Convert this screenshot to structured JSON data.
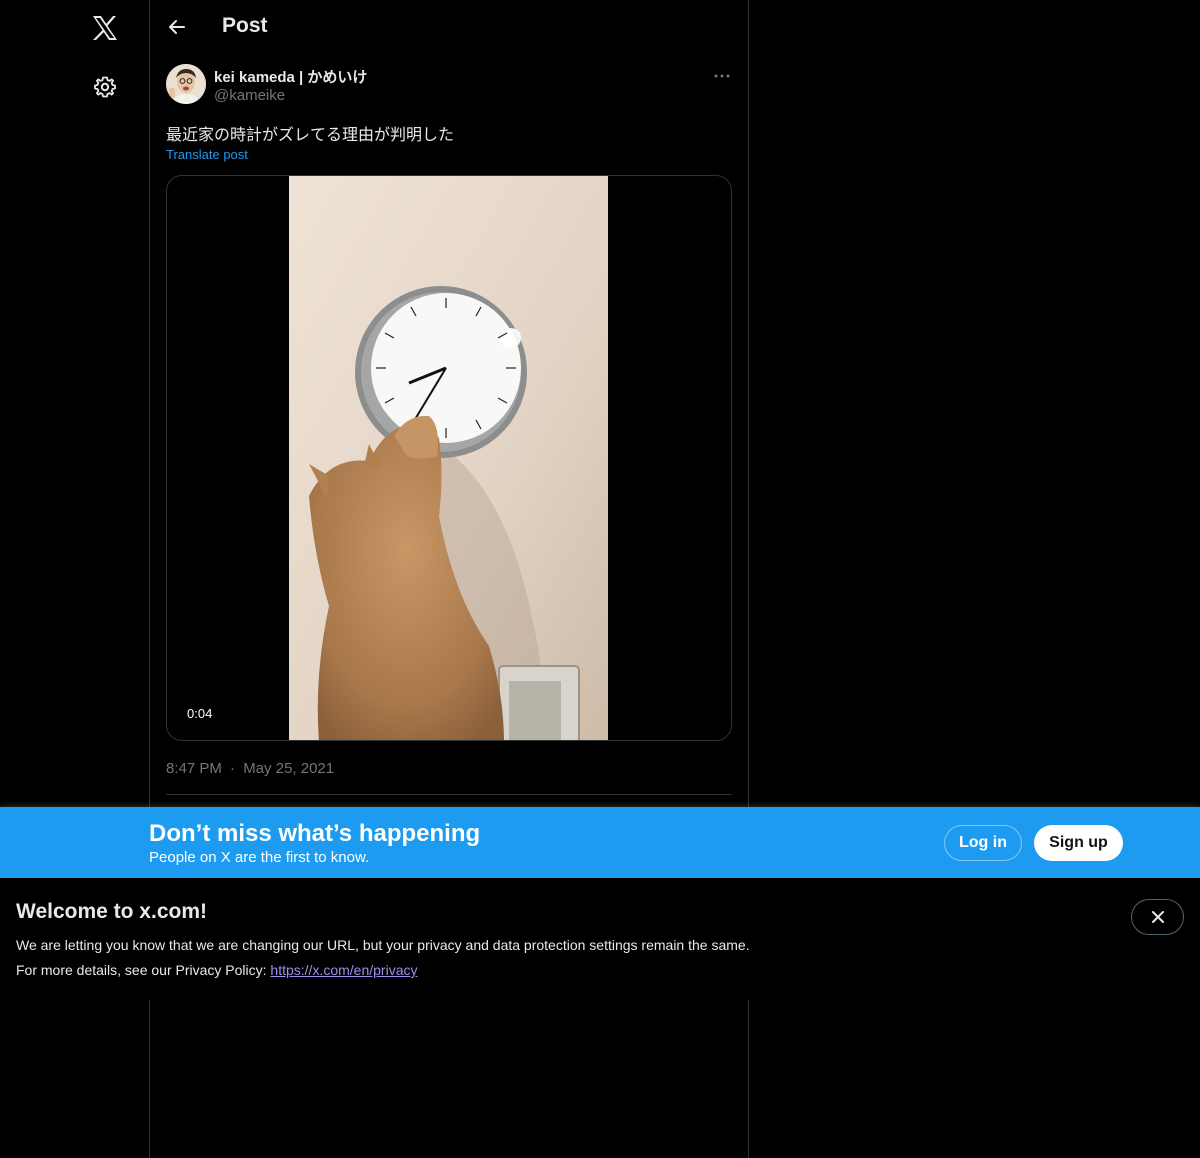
{
  "nav": {
    "logo_icon": "x-logo-icon",
    "settings_icon": "gear-icon"
  },
  "header": {
    "back_icon": "arrow-left-icon",
    "title": "Post"
  },
  "post": {
    "author_name": "kei kameda | かめいけ",
    "author_handle": "@kameike",
    "more_icon": "more-horizontal-icon",
    "text": "最近家の時計がズレてる理由が判明した",
    "translate_label": "Translate post",
    "video_time": "0:04",
    "time": "8:47 PM",
    "separator": "·",
    "date": "May 25, 2021"
  },
  "signup_bar": {
    "title": "Don’t miss what’s happening",
    "subtitle": "People on X are the first to know.",
    "login_label": "Log in",
    "signup_label": "Sign up"
  },
  "notice": {
    "title": "Welcome to x.com!",
    "line1": "We are letting you know that we are changing our URL, but your privacy and data protection settings remain the same.",
    "line2_prefix": "For more details, see our Privacy Policy: ",
    "link_text": "https://x.com/en/privacy",
    "close_icon": "close-icon"
  },
  "colors": {
    "background": "#000000",
    "accent": "#1d9bf0",
    "text_primary": "#e7e9ea",
    "text_secondary": "#71767b",
    "link_visited": "#9b8ff0"
  }
}
